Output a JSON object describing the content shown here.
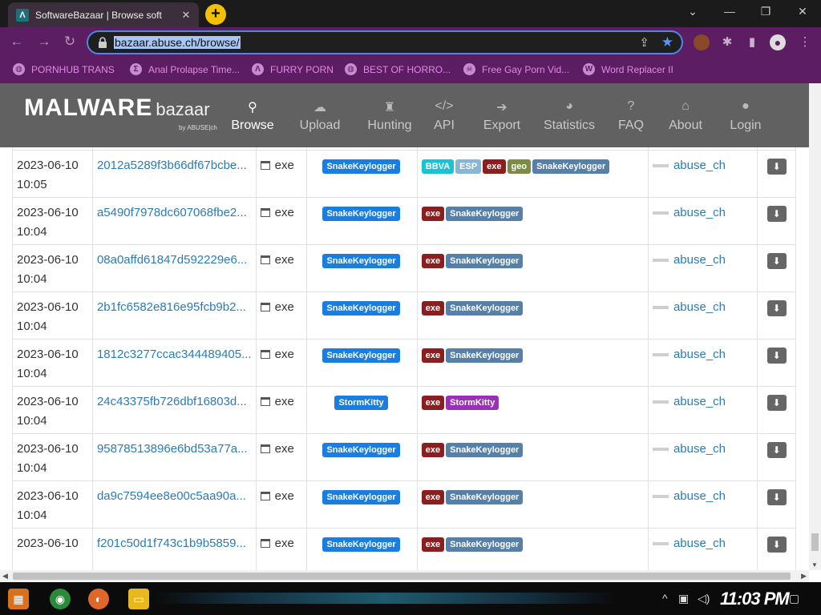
{
  "browser": {
    "tab_title": "SoftwareBazaar | Browse soft",
    "tab_favicon": "Λ",
    "new_tab": "+",
    "url": "bazaar.abuse.ch/browse/",
    "bookmarks": [
      {
        "label": "PORNHUB TRANS",
        "icon": "globe-icon"
      },
      {
        "label": "Anal Prolapse Time...",
        "icon": "sigma-icon"
      },
      {
        "label": "FURRY PORN",
        "icon": "lambda-icon"
      },
      {
        "label": "BEST OF HORRO...",
        "icon": "globe-icon"
      },
      {
        "label": "Free Gay Porn Vid...",
        "icon": "skull-icon"
      },
      {
        "label": "Word Replacer II",
        "icon": "wr-icon"
      }
    ]
  },
  "site": {
    "logo_main": "MALWARE",
    "logo_sub": "bazaar",
    "logo_by": "by ABUSE|ch",
    "nav": [
      {
        "label": "Browse",
        "icon": "search-icon",
        "active": true
      },
      {
        "label": "Upload",
        "icon": "cloud-upload-icon"
      },
      {
        "label": "Hunting",
        "icon": "castle-icon"
      },
      {
        "label": "API",
        "icon": "code-icon"
      },
      {
        "label": "Export",
        "icon": "export-icon"
      },
      {
        "label": "Statistics",
        "icon": "pie-chart-icon"
      },
      {
        "label": "FAQ",
        "icon": "question-icon"
      },
      {
        "label": "About",
        "icon": "building-icon"
      },
      {
        "label": "Login",
        "icon": "user-icon"
      }
    ]
  },
  "table": {
    "rows": [
      {
        "date": "",
        "time": "10:05",
        "hash": "",
        "type": "",
        "signature": "",
        "tags": [],
        "reporter": ""
      },
      {
        "date": "2023-06-10",
        "time": "10:05",
        "hash": "2012a5289f3b66df67bcbe...",
        "type": "exe",
        "signature": "SnakeKeylogger",
        "tags": [
          {
            "t": "BBVA",
            "c": "b-bbva"
          },
          {
            "t": "ESP",
            "c": "b-esp"
          },
          {
            "t": "exe",
            "c": "b-exe"
          },
          {
            "t": "geo",
            "c": "b-geo"
          },
          {
            "t": "SnakeKeylogger",
            "c": "b-sk"
          }
        ],
        "reporter": "abuse_ch"
      },
      {
        "date": "2023-06-10",
        "time": "10:04",
        "hash": "a5490f7978dc607068fbe2...",
        "type": "exe",
        "signature": "SnakeKeylogger",
        "tags": [
          {
            "t": "exe",
            "c": "b-exe"
          },
          {
            "t": "SnakeKeylogger",
            "c": "b-sk"
          }
        ],
        "reporter": "abuse_ch"
      },
      {
        "date": "2023-06-10",
        "time": "10:04",
        "hash": "08a0affd61847d592229e6...",
        "type": "exe",
        "signature": "SnakeKeylogger",
        "tags": [
          {
            "t": "exe",
            "c": "b-exe"
          },
          {
            "t": "SnakeKeylogger",
            "c": "b-sk"
          }
        ],
        "reporter": "abuse_ch"
      },
      {
        "date": "2023-06-10",
        "time": "10:04",
        "hash": "2b1fc6582e816e95fcb9b2...",
        "type": "exe",
        "signature": "SnakeKeylogger",
        "tags": [
          {
            "t": "exe",
            "c": "b-exe"
          },
          {
            "t": "SnakeKeylogger",
            "c": "b-sk"
          }
        ],
        "reporter": "abuse_ch"
      },
      {
        "date": "2023-06-10",
        "time": "10:04",
        "hash": "1812c3277ccac344489405...",
        "type": "exe",
        "signature": "SnakeKeylogger",
        "tags": [
          {
            "t": "exe",
            "c": "b-exe"
          },
          {
            "t": "SnakeKeylogger",
            "c": "b-sk"
          }
        ],
        "reporter": "abuse_ch"
      },
      {
        "date": "2023-06-10",
        "time": "10:04",
        "hash": "24c43375fb726dbf16803d...",
        "type": "exe",
        "signature": "StormKitty",
        "tags": [
          {
            "t": "exe",
            "c": "b-exe"
          },
          {
            "t": "StormKitty",
            "c": "b-storm"
          }
        ],
        "reporter": "abuse_ch"
      },
      {
        "date": "2023-06-10",
        "time": "10:04",
        "hash": "95878513896e6bd53a77a...",
        "type": "exe",
        "signature": "SnakeKeylogger",
        "tags": [
          {
            "t": "exe",
            "c": "b-exe"
          },
          {
            "t": "SnakeKeylogger",
            "c": "b-sk"
          }
        ],
        "reporter": "abuse_ch"
      },
      {
        "date": "2023-06-10",
        "time": "10:04",
        "hash": "da9c7594ee8e00c5aa90a...",
        "type": "exe",
        "signature": "SnakeKeylogger",
        "tags": [
          {
            "t": "exe",
            "c": "b-exe"
          },
          {
            "t": "SnakeKeylogger",
            "c": "b-sk"
          }
        ],
        "reporter": "abuse_ch"
      },
      {
        "date": "2023-06-10",
        "time": "",
        "hash": "f201c50d1f743c1b9b5859...",
        "type": "exe",
        "signature": "SnakeKeylogger",
        "tags": [
          {
            "t": "exe",
            "c": "b-exe"
          },
          {
            "t": "SnakeKeylogger",
            "c": "b-sk"
          }
        ],
        "reporter": "abuse_ch"
      }
    ]
  },
  "taskbar": {
    "clock": "11:03 PM",
    "apps": [
      "start-icon",
      "chrome-icon",
      "firefox-icon",
      "file-explorer-icon"
    ]
  },
  "colors": {
    "toolbar": "#5d1d63",
    "site_header": "#616161",
    "link": "#2b7bb9",
    "badge_blue": "#1a7ee0",
    "badge_exe": "#8b1e1e"
  }
}
